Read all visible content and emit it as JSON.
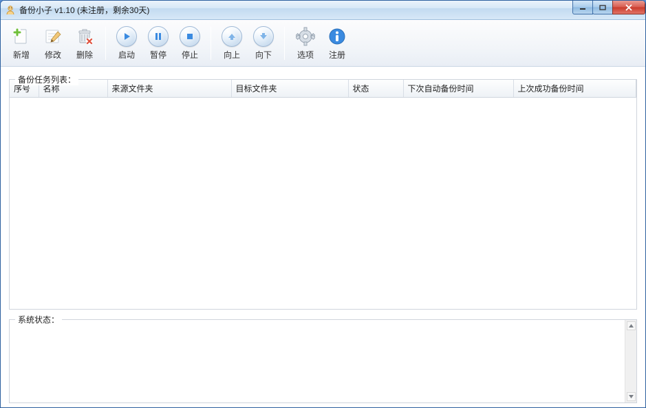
{
  "window": {
    "title": "备份小子 v1.10  (未注册，剩余30天)"
  },
  "toolbar": {
    "new_label": "新增",
    "edit_label": "修改",
    "delete_label": "删除",
    "start_label": "启动",
    "pause_label": "暂停",
    "stop_label": "停止",
    "moveup_label": "向上",
    "movedown_label": "向下",
    "options_label": "选项",
    "register_label": "注册"
  },
  "task_list": {
    "title": "备份任务列表：",
    "columns": {
      "seq": "序号",
      "name": "名称",
      "source": "来源文件夹",
      "target": "目标文件夹",
      "status": "状态",
      "next_time": "下次自动备份时间",
      "last_success": "上次成功备份时间"
    },
    "rows": []
  },
  "system_status": {
    "title": "系统状态：",
    "value": ""
  },
  "colors": {
    "titlebar_gradient_top": "#eaf3fb",
    "close_red": "#c93a2b",
    "accent_blue": "#3a8ae0",
    "green": "#6fbf3a"
  }
}
